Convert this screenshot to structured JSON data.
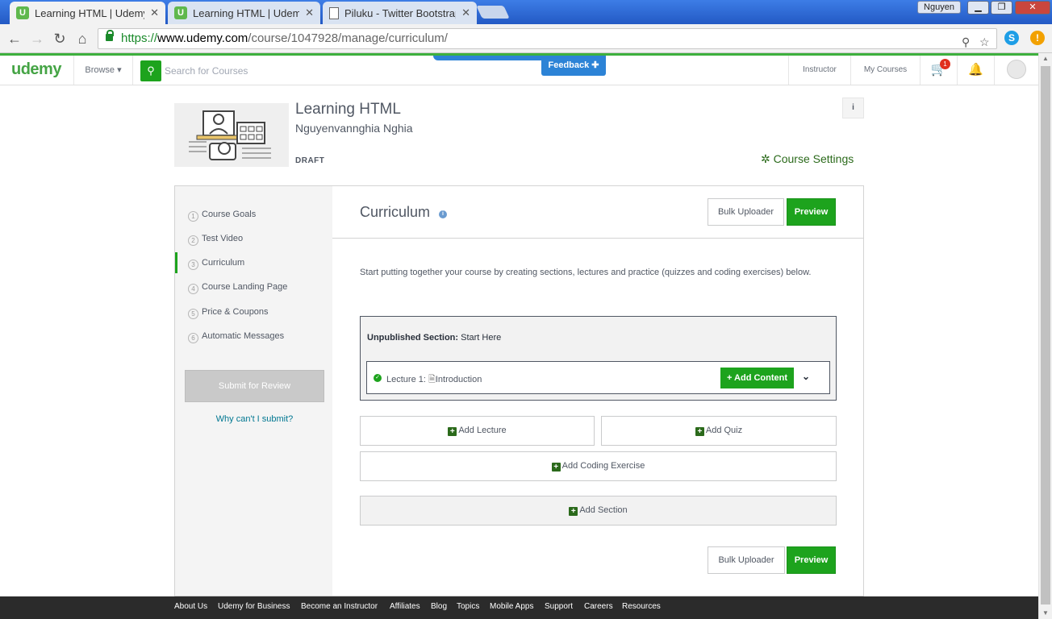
{
  "browser": {
    "tabs": [
      {
        "title": "Learning HTML | Udemy",
        "favicon": "U",
        "close": "✕"
      },
      {
        "title": "Learning HTML | Udemy",
        "favicon": "U",
        "close": "✕"
      },
      {
        "title": "Piluku - Twitter Bootstrap",
        "favicon": "",
        "close": "✕"
      }
    ],
    "profile_name": "Nguyen",
    "url": {
      "scheme": "https://",
      "host": "www.udemy.com",
      "path": "/course/1047928/manage/curriculum/"
    }
  },
  "site_header": {
    "logo": "udemy",
    "browse_label": "Browse ▾",
    "search_placeholder": "Search for Courses",
    "feedback_label": "Feedback ✚",
    "instructor_label": "Instructor",
    "my_courses_label": "My Courses",
    "cart_count": "1"
  },
  "course": {
    "title": "Learning HTML",
    "author": "Nguyenvannghia Nghia",
    "status": "DRAFT",
    "info_label": "i",
    "settings_label": "Course Settings"
  },
  "sidebar": {
    "steps": [
      {
        "num": "1",
        "label": "Course Goals"
      },
      {
        "num": "2",
        "label": "Test Video"
      },
      {
        "num": "3",
        "label": "Curriculum"
      },
      {
        "num": "4",
        "label": "Course Landing Page"
      },
      {
        "num": "5",
        "label": "Price & Coupons"
      },
      {
        "num": "6",
        "label": "Automatic Messages"
      }
    ],
    "active_step": 3,
    "submit_label": "Submit for Review",
    "why_label": "Why can't I submit?"
  },
  "curriculum": {
    "title": "Curriculum",
    "bulk_uploader_label": "Bulk Uploader",
    "preview_label": "Preview",
    "intro_text": "Start putting together your course by creating sections, lectures and practice (quizzes and coding exercises) below.",
    "section": {
      "prefix": "Unpublished Section:",
      "name": "Start Here",
      "lecture_prefix": "Lecture 1:",
      "lecture_title": "Introduction",
      "add_content_label": "+ Add Content"
    },
    "add_lecture_label": "Add Lecture",
    "add_quiz_label": "Add Quiz",
    "add_coding_label": "Add Coding Exercise",
    "add_section_label": "Add Section"
  },
  "footer": {
    "links": [
      "About Us",
      "Udemy for Business",
      "Become an Instructor",
      "Affiliates",
      "Blog",
      "Topics",
      "Mobile Apps",
      "Support",
      "Careers",
      "Resources"
    ]
  },
  "colors": {
    "brand_green": "#1da31d",
    "link_blue": "#007791",
    "feedback_blue": "#2c83d6",
    "footer_bg": "#2b2b2b"
  }
}
